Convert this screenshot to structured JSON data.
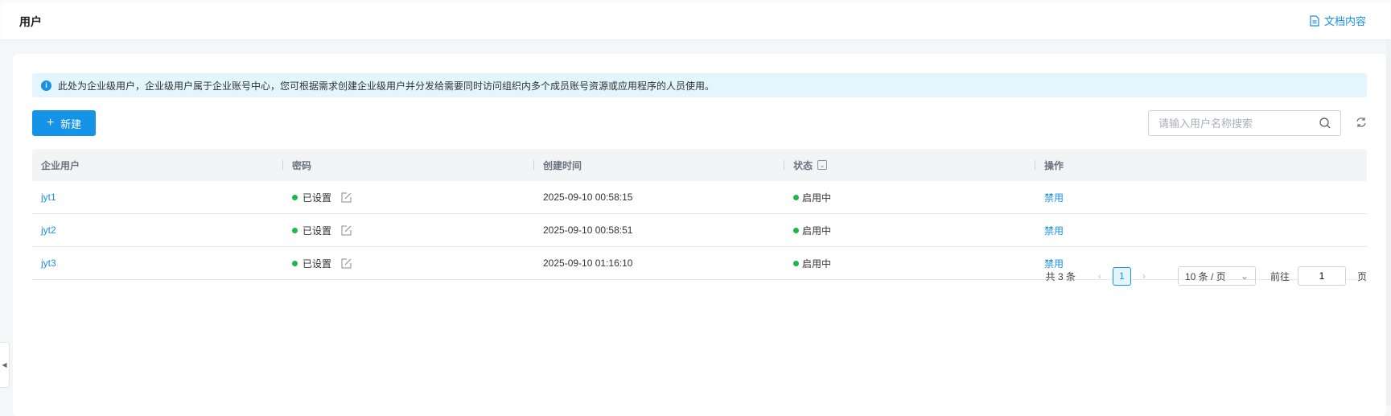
{
  "header": {
    "title": "用户",
    "doc_link": "文档内容"
  },
  "info": {
    "text": "此处为企业级用户，企业级用户属于企业账号中心，您可根据需求创建企业级用户并分发给需要同时访问组织内多个成员账号资源或应用程序的人员使用。"
  },
  "toolbar": {
    "new_label": "新建",
    "search_placeholder": "请输入用户名称搜索"
  },
  "table": {
    "columns": [
      "企业用户",
      "密码",
      "创建时间",
      "状态",
      "操作"
    ],
    "rows": [
      {
        "user": "jyt1",
        "password": "已设置",
        "created": "2025-09-10 00:58:15",
        "status": "启用中",
        "action": "禁用"
      },
      {
        "user": "jyt2",
        "password": "已设置",
        "created": "2025-09-10 00:58:51",
        "status": "启用中",
        "action": "禁用"
      },
      {
        "user": "jyt3",
        "password": "已设置",
        "created": "2025-09-10 01:16:10",
        "status": "启用中",
        "action": "禁用"
      }
    ]
  },
  "pagination": {
    "total": "共 3 条",
    "current": "1",
    "page_size": "10 条 / 页",
    "goto_label": "前往",
    "goto_value": "1",
    "page_suffix": "页"
  },
  "colors": {
    "accent": "#1890e6",
    "status_green": "#1db84a",
    "info_bg": "#e3f5fd"
  }
}
